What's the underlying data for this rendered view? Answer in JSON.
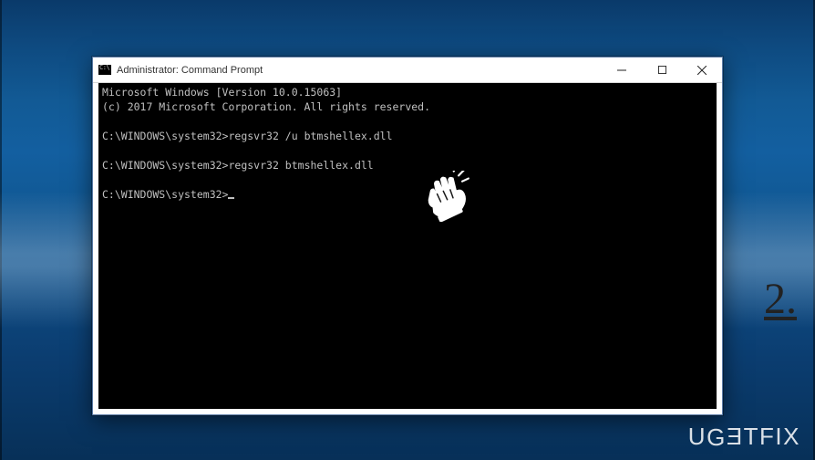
{
  "background": {
    "decoration_number": "2."
  },
  "watermark": {
    "text": "UGETFIX"
  },
  "window": {
    "title": "Administrator: Command Prompt",
    "controls": {
      "minimize_label": "Minimize",
      "maximize_label": "Maximize",
      "close_label": "Close"
    }
  },
  "terminal": {
    "banner_line1": "Microsoft Windows [Version 10.0.15063]",
    "banner_line2": "(c) 2017 Microsoft Corporation. All rights reserved.",
    "prompt": "C:\\WINDOWS\\system32>",
    "lines": [
      {
        "prompt": "C:\\WINDOWS\\system32>",
        "command": "regsvr32 /u btmshellex.dll"
      },
      {
        "prompt": "C:\\WINDOWS\\system32>",
        "command": "regsvr32 btmshellex.dll"
      }
    ],
    "current_prompt": "C:\\WINDOWS\\system32>"
  }
}
